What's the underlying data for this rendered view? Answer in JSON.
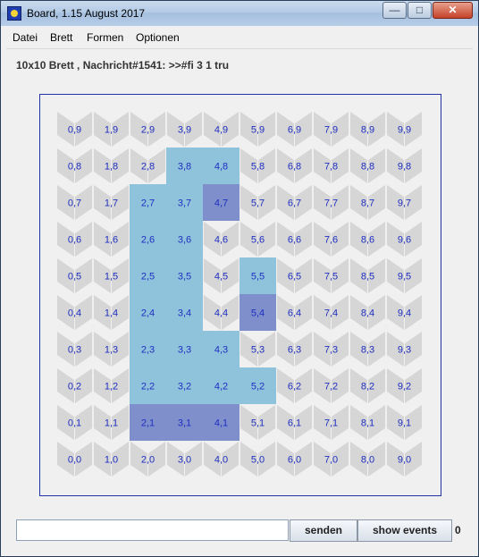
{
  "window": {
    "title": "Board, 1.15 August 2017",
    "minimize": "—",
    "maximize": "□",
    "close": "✕"
  },
  "menu": {
    "items": [
      "Datei",
      "Brett",
      "Formen",
      "Optionen"
    ]
  },
  "status": {
    "text": "10x10 Brett , Nachricht#1541: >>#fi 3 1 tru"
  },
  "board": {
    "cols": 10,
    "rows": 10,
    "colors": {
      "light_blue": "#8fc3dc",
      "dark_blue": "#7e8fcb",
      "gray": "#d6d6d6",
      "label": "#1f2fc0",
      "frame": "#2233aa"
    },
    "light_cells": [
      "2,7",
      "2,6",
      "2,5",
      "2,4",
      "2,3",
      "2,2",
      "3,8",
      "3,7",
      "3,6",
      "3,5",
      "3,4",
      "3,3",
      "3,2",
      "4,8",
      "4,3",
      "4,2",
      "5,5",
      "5,2"
    ],
    "dark_cells": [
      "2,1",
      "3,1",
      "4,7",
      "4,1",
      "5,4"
    ],
    "labels": [
      [
        "0,9",
        "1,9",
        "2,9",
        "3,9",
        "4,9",
        "5,9",
        "6,9",
        "7,9",
        "8,9",
        "9,9"
      ],
      [
        "0,8",
        "1,8",
        "2,8",
        "3,8",
        "4,8",
        "5,8",
        "6,8",
        "7,8",
        "8,8",
        "9,8"
      ],
      [
        "0,7",
        "1,7",
        "2,7",
        "3,7",
        "4,7",
        "5,7",
        "6,7",
        "7,7",
        "8,7",
        "9,7"
      ],
      [
        "0,6",
        "1,6",
        "2,6",
        "3,6",
        "4,6",
        "5,6",
        "6,6",
        "7,6",
        "8,6",
        "9,6"
      ],
      [
        "0,5",
        "1,5",
        "2,5",
        "3,5",
        "4,5",
        "5,5",
        "6,5",
        "7,5",
        "8,5",
        "9,5"
      ],
      [
        "0,4",
        "1,4",
        "2,4",
        "3,4",
        "4,4",
        "5,4",
        "6,4",
        "7,4",
        "8,4",
        "9,4"
      ],
      [
        "0,3",
        "1,3",
        "2,3",
        "3,3",
        "4,3",
        "5,3",
        "6,3",
        "7,3",
        "8,3",
        "9,3"
      ],
      [
        "0,2",
        "1,2",
        "2,2",
        "3,2",
        "4,2",
        "5,2",
        "6,2",
        "7,2",
        "8,2",
        "9,2"
      ],
      [
        "0,1",
        "1,1",
        "2,1",
        "3,1",
        "4,1",
        "5,1",
        "6,1",
        "7,1",
        "8,1",
        "9,1"
      ],
      [
        "0,0",
        "1,0",
        "2,0",
        "3,0",
        "4,0",
        "5,0",
        "6,0",
        "7,0",
        "8,0",
        "9,0"
      ]
    ]
  },
  "controls": {
    "message_value": "",
    "send_label": "senden",
    "events_label": "show events",
    "event_count": "0"
  }
}
